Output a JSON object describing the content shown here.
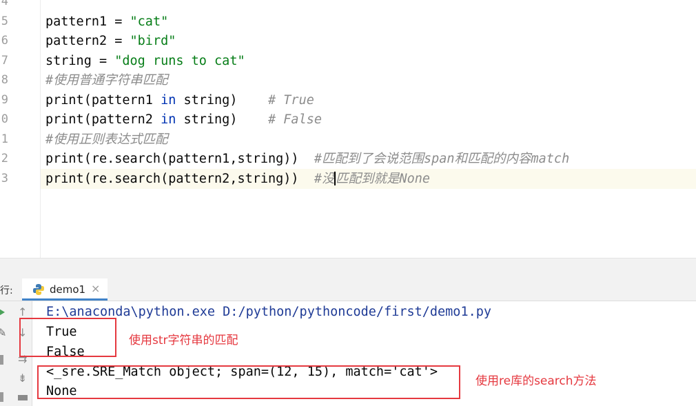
{
  "editor": {
    "line_numbers": [
      "4",
      "5",
      "6",
      "7",
      "8",
      "9",
      "0",
      "1",
      "2",
      "3"
    ],
    "lines": [
      {
        "p1": "pattern1 = ",
        "s": "\"cat\""
      },
      {
        "p1": "pattern2 = ",
        "s": "\"bird\""
      },
      {
        "p1": "string = ",
        "s": "\"dog runs to cat\""
      },
      {
        "comment": "#使用普通字符串匹配"
      },
      {
        "a": "print(pattern1 ",
        "kw": "in",
        "b": " string)    ",
        "comment": "# True"
      },
      {
        "a": "print(pattern2 ",
        "kw": "in",
        "b": " string)    ",
        "comment": "# False"
      },
      {
        "comment": "#使用正则表达式匹配"
      },
      {
        "a": "print(re.search(pattern1,string))  ",
        "comment": "#匹配到了会说范围span和匹配的内容match"
      },
      {
        "a": "print(re.search(pattern2,string))  ",
        "comment_a": "#没",
        "comment_b": "匹配到就是None"
      }
    ]
  },
  "run_panel": {
    "label": "运行:",
    "tab_title": "demo1",
    "tab_close": "×",
    "icons": [
      "run-icon",
      "up-arrow-icon",
      "wrench-icon",
      "down-arrow-icon",
      "stop-icon",
      "wrap-icon",
      "print-icon",
      "sort-icon"
    ]
  },
  "console": {
    "lines": [
      "E:\\anaconda\\python.exe D:/python/pythoncode/first/demo1.py",
      "True",
      "False",
      "<_sre.SRE_Match object; span=(12, 15), match='cat'>",
      "None"
    ]
  },
  "annotations": {
    "note1": "使用str字符串的匹配",
    "note2": "使用re库的search方法"
  },
  "colors": {
    "string": "#067d17",
    "keyword": "#0033b3",
    "comment": "#8c8c8c",
    "path": "#1f3b96",
    "annotation": "#e5383f",
    "tab_underline": "#4083c9"
  }
}
